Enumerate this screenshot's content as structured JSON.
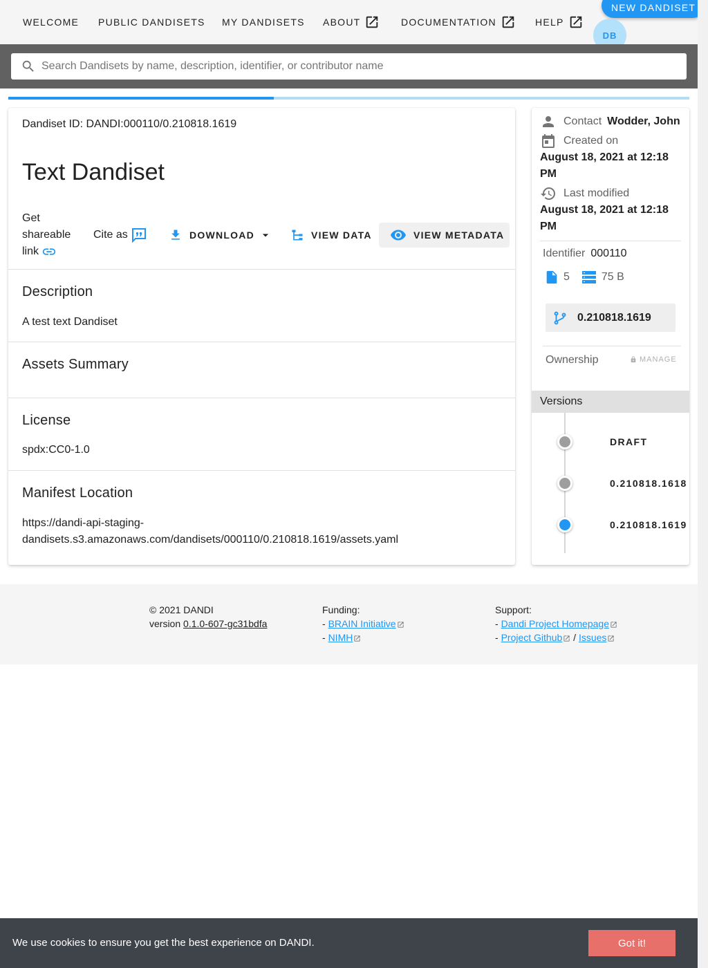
{
  "nav": {
    "welcome": "WELCOME",
    "public_dandisets": "PUBLIC DANDISETS",
    "my_dandisets": "MY DANDISETS",
    "about": "ABOUT",
    "documentation": "DOCUMENTATION",
    "help": "HELP",
    "new_dandiset": "NEW DANDISET",
    "avatar_initials": "DB"
  },
  "search": {
    "placeholder": "Search Dandisets by name, description, identifier, or contributor name",
    "value": ""
  },
  "progress": {
    "fraction": 0.39
  },
  "dandiset": {
    "id_line": "Dandiset ID: DANDI:000110/0.210818.1619",
    "title": "Text Dandiset",
    "shareable_link": "Get shareable link",
    "cite_as": "Cite as",
    "download": "DOWNLOAD",
    "view_data": "VIEW DATA",
    "view_metadata": "VIEW METADATA"
  },
  "sections": {
    "description_title": "Description",
    "description_text": "A test text Dandiset",
    "assets_summary_title": "Assets Summary",
    "license_title": "License",
    "license_text": "spdx:CC0-1.0",
    "manifest_title": "Manifest Location",
    "manifest_text": "https://dandi-api-staging-dandisets.s3.amazonaws.com/dandisets/000110/0.210818.1619/assets.yaml"
  },
  "sidebar": {
    "contact_label": "Contact",
    "contact_value": "Wodder, John",
    "created_label": "Created on",
    "created_value": "August 18, 2021 at 12:18 PM",
    "modified_label": "Last modified",
    "modified_value": "August 18, 2021 at 12:18 PM",
    "identifier_label": "Identifier",
    "identifier_value": "000110",
    "file_count": "5",
    "size": "75 B",
    "current_version": "0.210818.1619",
    "ownership_label": "Ownership",
    "manage_label": "MANAGE",
    "versions_title": "Versions",
    "versions": [
      {
        "label": "DRAFT",
        "color": "#9e9e9e"
      },
      {
        "label": "0.210818.1618",
        "color": "#9e9e9e"
      },
      {
        "label": "0.210818.1619",
        "color": "#2196f3"
      }
    ]
  },
  "footer": {
    "copyright": "© 2021 DANDI",
    "version_prefix": "version",
    "version_link": "0.1.0-607-gc31bdfa",
    "funding_title": "Funding:",
    "funding_links": [
      "BRAIN Initiative",
      "NIMH"
    ],
    "support_title": "Support:",
    "support_homepage": "Dandi Project Homepage",
    "support_github": "Project Github",
    "support_sep": "/",
    "support_issues": "Issues"
  },
  "cookie": {
    "text": "We use cookies to ensure you get the best experience on DANDI.",
    "button": "Got it!"
  },
  "colors": {
    "accent": "#2196f3",
    "version_inactive": "#9e9e9e",
    "cookie_bar": "#3f434a",
    "cookie_button": "#e8706a"
  }
}
